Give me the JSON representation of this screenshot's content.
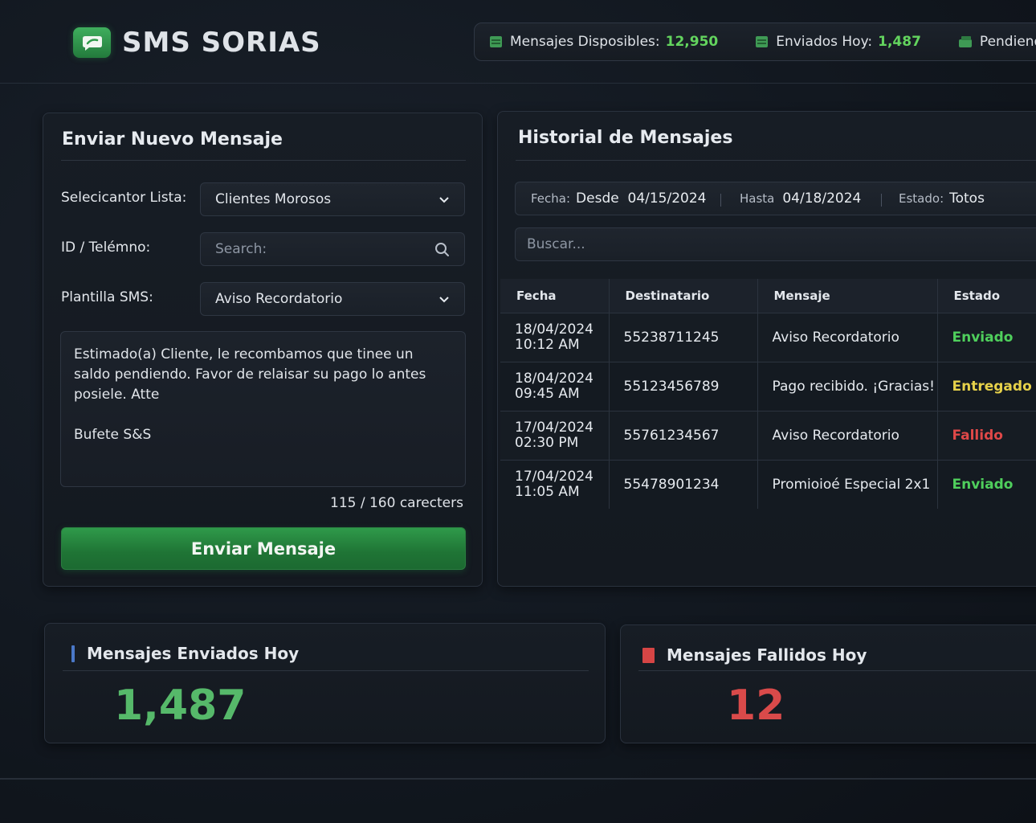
{
  "app": {
    "name": "SMS SORIAS"
  },
  "header_stats": [
    {
      "label": "Mensajes Disposibles:",
      "value": "12,950"
    },
    {
      "label": "Enviados Hoy:",
      "value": "1,487"
    },
    {
      "label": "Pendiendes:",
      "value": ""
    }
  ],
  "send_form": {
    "title": "Enviar Nuevo Mensaje",
    "list_label": "Selecicantor Lista:",
    "list_value": "Clientes Morosos",
    "id_label": "ID / Telémno:",
    "id_placeholder": "Search:",
    "template_label": "Plantilla SMS:",
    "template_value": "Aviso Recordatorio",
    "message": "Estimado(a) Cliente, le recombamos que tinee un\nsaldo pendiendo. Favor de relaisar su pago lo antes\nposiele. Atte\n\nBufete S&S",
    "char_count": "115 / 160 carecters",
    "send_label": "Enviar Mensaje"
  },
  "history": {
    "title": "Historial de Mensajes",
    "filters": {
      "fecha_label": "Fecha:",
      "desde_value": "Desde  04/15/2024",
      "hasta_label": "Hasta",
      "hasta_value": "04/18/2024",
      "estado_label": "Estado:",
      "estado_value": "Totos"
    },
    "search_placeholder": "Buscar...",
    "columns": [
      "Fecha",
      "Destinatario",
      "Mensaje",
      "Estado"
    ],
    "rows": [
      {
        "date": "18/04/2024",
        "time": "10:12 AM",
        "to": "55238711245",
        "message": "Aviso Recordatorio",
        "status": "Enviado"
      },
      {
        "date": "18/04/2024",
        "time": "09:45 AM",
        "to": "55123456789",
        "message": "Pago recibido. ¡Gracias!",
        "status": "Entregado"
      },
      {
        "date": "17/04/2024",
        "time": "02:30 PM",
        "to": "55761234567",
        "message": "Aviso Recordatorio",
        "status": "Fallido"
      },
      {
        "date": "17/04/2024",
        "time": "11:05 AM",
        "to": "55478901234",
        "message": "Promioioé Especial 2x1",
        "status": "Enviado"
      }
    ]
  },
  "summary": {
    "sent_title": "Mensajes Enviados Hoy",
    "sent_value": "1,487",
    "failed_title": "Mensajes Fallidos Hoy",
    "failed_value": "12"
  },
  "colors": {
    "accent_green": "#63d45e",
    "status_enviado": "#4fcf5c",
    "status_entregado": "#e6d14a",
    "status_fallido": "#e04848",
    "sent_value": "#56b96a",
    "failed_value": "#d94a4a",
    "sent_marker": "#4a78c8",
    "failed_marker": "#d64545"
  },
  "icons": {
    "logo": "chat-bubble-icon",
    "header_stat": "sms-stack-icon",
    "dropdown": "chevron-down-icon",
    "search": "search-icon"
  }
}
